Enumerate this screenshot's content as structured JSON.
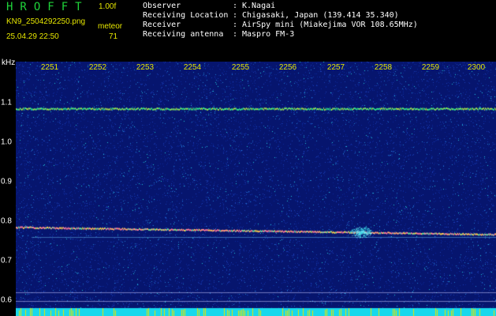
{
  "header": {
    "app_title": "HROFFT",
    "version": "1.00f",
    "filename": "KN9_2504292250.png",
    "meteor_label": "meteor",
    "meteor_count": "71",
    "datetime": "25.04.29 22:50"
  },
  "info": [
    {
      "key": "Observer",
      "value": "K.Nagai"
    },
    {
      "key": "Receiving Location",
      "value": "Chigasaki, Japan (139.414 35.340)"
    },
    {
      "key": "Receiver",
      "value": "AirSpy mini (Miakejima VOR 108.65MHz)"
    },
    {
      "key": "Receiving antenna",
      "value": "Maspro FM-3"
    }
  ],
  "separator": ":",
  "axis": {
    "unit": "kHz",
    "x_ticks": [
      "2251",
      "2252",
      "2253",
      "2254",
      "2255",
      "2256",
      "2257",
      "2258",
      "2259",
      "2300"
    ],
    "y_ticks": [
      "1.1",
      "1.0",
      "0.9",
      "0.8",
      "0.7",
      "0.6"
    ]
  },
  "colors": {
    "background": "#06156e",
    "noise_low": "#1a3fb8",
    "noise_high": "#22c7d8",
    "trace_top": "#2ee58a",
    "trace_bottom": "#ff7a9a",
    "ticks_x": "#e6e600",
    "title": "#1fd43a"
  }
}
